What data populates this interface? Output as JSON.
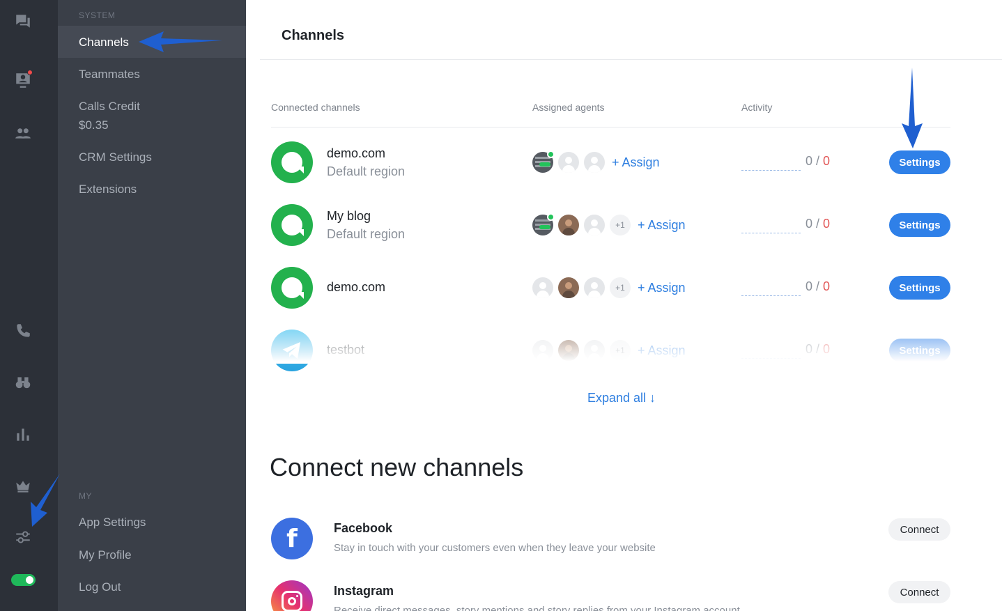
{
  "rail": {
    "icons": [
      "chat-icon",
      "contact-card-icon",
      "team-icon",
      "phone-icon",
      "binoculars-icon",
      "bar-chart-icon",
      "crown-icon",
      "sliders-icon"
    ],
    "notification_color": "#f24b4b",
    "toggle_on": true
  },
  "subnav": {
    "system_label": "SYSTEM",
    "items": [
      {
        "label": "Channels"
      },
      {
        "label": "Teammates"
      },
      {
        "label": "Calls Credit",
        "sub": "$0.35"
      },
      {
        "label": "CRM Settings"
      },
      {
        "label": "Extensions"
      }
    ],
    "my_label": "MY",
    "my_items": [
      {
        "label": "App Settings"
      },
      {
        "label": "My Profile"
      },
      {
        "label": "Log Out"
      }
    ]
  },
  "main": {
    "title": "Channels",
    "columns": {
      "connected": "Connected channels",
      "agents": "Assigned agents",
      "activity": "Activity"
    },
    "channels": [
      {
        "name": "demo.com",
        "region": "Default region",
        "extra": "",
        "assign": "+ Assign",
        "count_a": "0",
        "sep": " / ",
        "count_b": "0",
        "settings": "Settings"
      },
      {
        "name": "My blog",
        "region": "Default region",
        "extra": "+1",
        "assign": "+ Assign",
        "count_a": "0",
        "sep": " / ",
        "count_b": "0",
        "settings": "Settings"
      },
      {
        "name": "demo.com",
        "region": "",
        "extra": "+1",
        "assign": "+ Assign",
        "count_a": "0",
        "sep": " / ",
        "count_b": "0",
        "settings": "Settings"
      },
      {
        "name": "testbot",
        "region": "",
        "extra": "+1",
        "assign": "+ Assign",
        "count_a": "0",
        "sep": " / ",
        "count_b": "0",
        "settings": "Settings"
      }
    ],
    "expand_all": "Expand all ↓",
    "connect_title": "Connect new channels",
    "new_channels": [
      {
        "name": "Facebook",
        "description": "Stay in touch with your customers even when they leave your website",
        "button": "Connect",
        "logo_text": "f"
      },
      {
        "name": "Instagram",
        "description": "Receive direct messages, story mentions and story replies from your Instagram account",
        "button": "Connect"
      }
    ],
    "accent_color": "#2f80e8",
    "channel_green": "#23b14d"
  }
}
